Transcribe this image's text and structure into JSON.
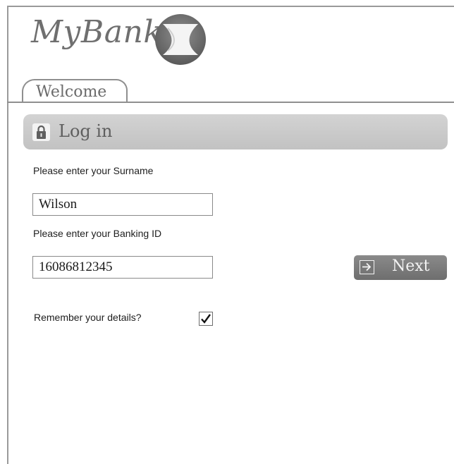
{
  "brand": {
    "name": "MyBank",
    "logo_icon": "hourglass-circle-icon"
  },
  "tabs": [
    {
      "label": "Welcome"
    }
  ],
  "login": {
    "heading": "Log in",
    "icon": "lock-icon"
  },
  "form": {
    "surname_label": "Please enter your Surname",
    "surname_value": "Wilson",
    "banking_id_label": "Please enter your Banking ID",
    "banking_id_value": "16086812345",
    "remember_label": "Remember your details?",
    "remember_checked": true
  },
  "actions": {
    "next_label": "Next",
    "next_icon": "arrow-right-icon"
  },
  "colors": {
    "bar": "#c8c8c8",
    "button": "#7a7a7a",
    "border": "#8f8f8f"
  }
}
